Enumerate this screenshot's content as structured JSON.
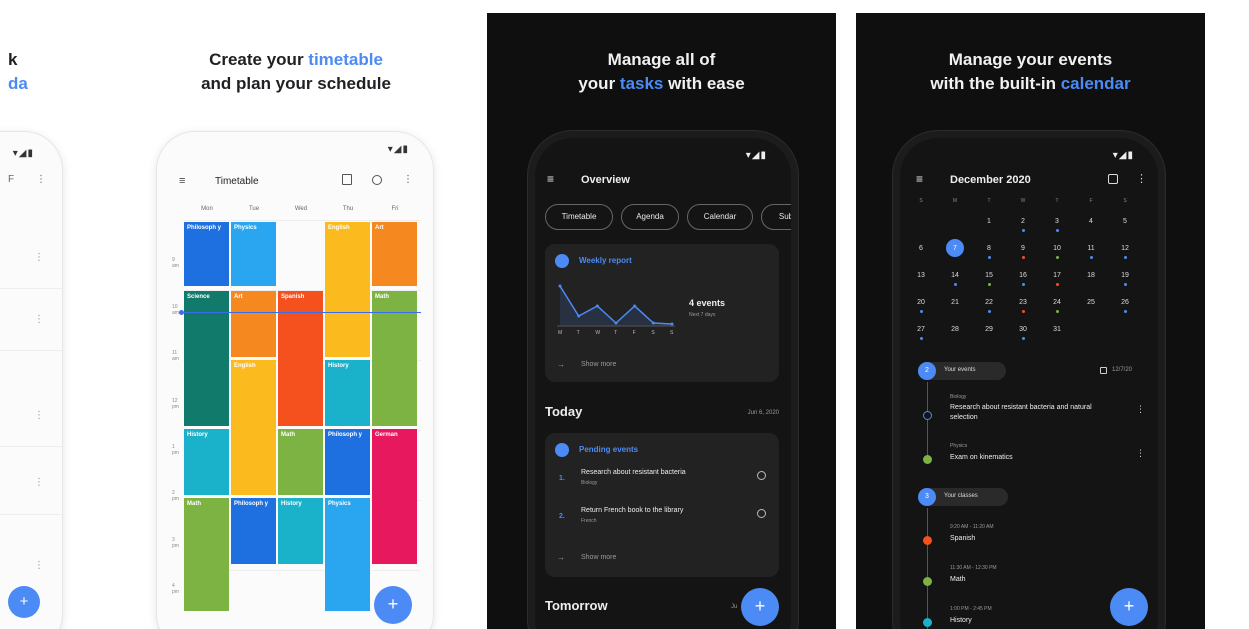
{
  "panel1": {
    "headline_fragment_1": "k",
    "headline_fragment_2": "da",
    "status": "▾◢▮",
    "toolbar_icon": "F",
    "rows": [
      "⋮",
      "⋮",
      "⋮",
      "⋮",
      "⋮"
    ],
    "fab": "+"
  },
  "panel2": {
    "headline_pre": "Create your ",
    "headline_accent": "timetable",
    "headline_line2": "and plan your schedule",
    "status": "▾◢▮",
    "title": "Timetable",
    "days": [
      "Mon",
      "Tue",
      "Wed",
      "Thu",
      "Fri"
    ],
    "times": [
      "9\nam",
      "10\nam",
      "11\nam",
      "12\npm",
      "1\npm",
      "2\npm",
      "3\npm",
      "4\npm"
    ],
    "blocks": [
      {
        "label": "Philosoph y",
        "color": "#1e6fe0"
      },
      {
        "label": "Physics",
        "color": "#2aa6f0"
      },
      {
        "label": "English",
        "color": "#fbba1d"
      },
      {
        "label": "Art",
        "color": "#f5891f"
      },
      {
        "label": "Science",
        "color": "#127a6b"
      },
      {
        "label": "Art",
        "color": "#f5891f"
      },
      {
        "label": "Spanish",
        "color": "#f4511e"
      },
      {
        "label": "Math",
        "color": "#7cb342"
      },
      {
        "label": "English",
        "color": "#fbba1d"
      },
      {
        "label": "History",
        "color": "#1ab2cb"
      },
      {
        "label": "History",
        "color": "#1ab2cb"
      },
      {
        "label": "Math",
        "color": "#7cb342"
      },
      {
        "label": "Philosoph y",
        "color": "#1e6fe0"
      },
      {
        "label": "German",
        "color": "#e8185e"
      },
      {
        "label": "Math",
        "color": "#7cb342"
      },
      {
        "label": "Philosoph y",
        "color": "#1e6fe0"
      },
      {
        "label": "History",
        "color": "#1ab2cb"
      },
      {
        "label": "Physics",
        "color": "#2aa6f0"
      }
    ],
    "fab": "+"
  },
  "panel3": {
    "headline_line1": "Manage all of",
    "headline_pre": "your ",
    "headline_accent": "tasks",
    "headline_post": " with ease",
    "status": "▾◢▮",
    "title": "Overview",
    "chips": [
      "Timetable",
      "Agenda",
      "Calendar",
      "Sub"
    ],
    "weekly_report": {
      "title": "Weekly report",
      "count": "4 events",
      "sub": "Next 7 days",
      "days": [
        "M",
        "T",
        "W",
        "T",
        "F",
        "S",
        "S"
      ],
      "values": [
        4,
        1,
        2,
        0.3,
        2,
        0.3,
        0.2
      ],
      "show_more": "Show more"
    },
    "today": {
      "label": "Today",
      "date": "Jun 6, 2020"
    },
    "pending": {
      "title": "Pending events",
      "items": [
        {
          "num": "1.",
          "title": "Research about resistant bacteria",
          "subject": "Biology"
        },
        {
          "num": "2.",
          "title": "Return French book to the library",
          "subject": "French"
        }
      ],
      "show_more": "Show more"
    },
    "tomorrow": "Tomorrow",
    "tomorrow_date_frag": "Ju",
    "fab": "+"
  },
  "panel4": {
    "headline_line1": "Manage your events",
    "headline_pre": "with the built-in ",
    "headline_accent": "calendar",
    "status": "▾◢▮",
    "title": "December 2020",
    "weekdays": [
      "S",
      "M",
      "T",
      "W",
      "T",
      "F",
      "S"
    ],
    "weeks": [
      [
        "",
        "",
        "1",
        "2",
        "3",
        "4",
        "5"
      ],
      [
        "6",
        "7",
        "8",
        "9",
        "10",
        "11",
        "12"
      ],
      [
        "13",
        "14",
        "15",
        "16",
        "17",
        "18",
        "19"
      ],
      [
        "20",
        "21",
        "22",
        "23",
        "24",
        "25",
        "26"
      ],
      [
        "27",
        "28",
        "29",
        "30",
        "31",
        "",
        ""
      ]
    ],
    "selected_day": "7",
    "your_events": {
      "count": "2",
      "label": "Your events",
      "date": "12/7/20"
    },
    "events": [
      {
        "subject": "Biology",
        "title": "Research about resistant bacteria and natural selection"
      },
      {
        "subject": "Physics",
        "title": "Exam on kinematics"
      }
    ],
    "your_classes": {
      "count": "3",
      "label": "Your classes"
    },
    "classes": [
      {
        "time": "9:20 AM - 11:20 AM",
        "title": "Spanish",
        "color": "#f4511e"
      },
      {
        "time": "11:30 AM - 12:30 PM",
        "title": "Math",
        "color": "#7cb342"
      },
      {
        "time": "1:00 PM - 2:45 PM",
        "title": "History",
        "color": "#1ab2cb"
      }
    ],
    "fab": "+"
  },
  "colors": {
    "accent": "#4c8bf5",
    "dark_bg": "#141414",
    "card_bg": "#222222"
  }
}
